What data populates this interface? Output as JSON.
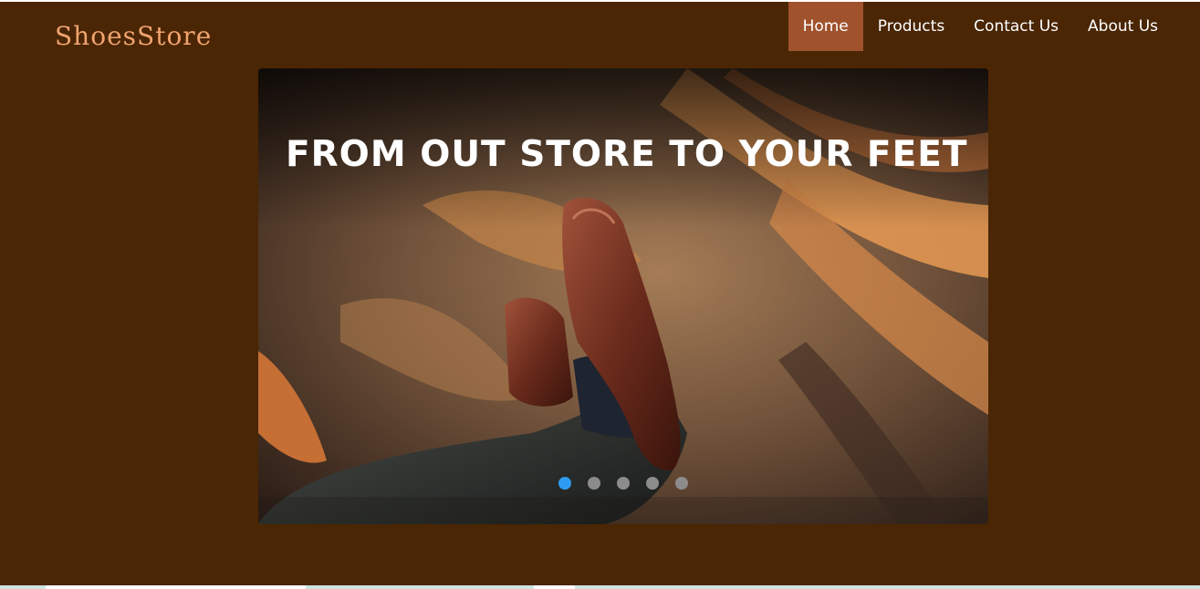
{
  "site": {
    "brand": "ShoesStore"
  },
  "nav": {
    "items": [
      {
        "label": "Home",
        "active": true
      },
      {
        "label": "Products",
        "active": false
      },
      {
        "label": "Contact Us",
        "active": false
      },
      {
        "label": "About Us",
        "active": false
      }
    ]
  },
  "hero": {
    "caption": "FROM OUT STORE TO YOUR FEET",
    "image": "brown-leather-brogue-shoes-on-carpet",
    "slide_count": 5,
    "active_slide": 1
  },
  "colors": {
    "header_bg": "#4a2605",
    "brand_text": "#f0a36e",
    "nav_active_bg": "#a0522d",
    "indicator_active": "#2d9bef",
    "indicator_inactive": "#8c8c8c"
  }
}
